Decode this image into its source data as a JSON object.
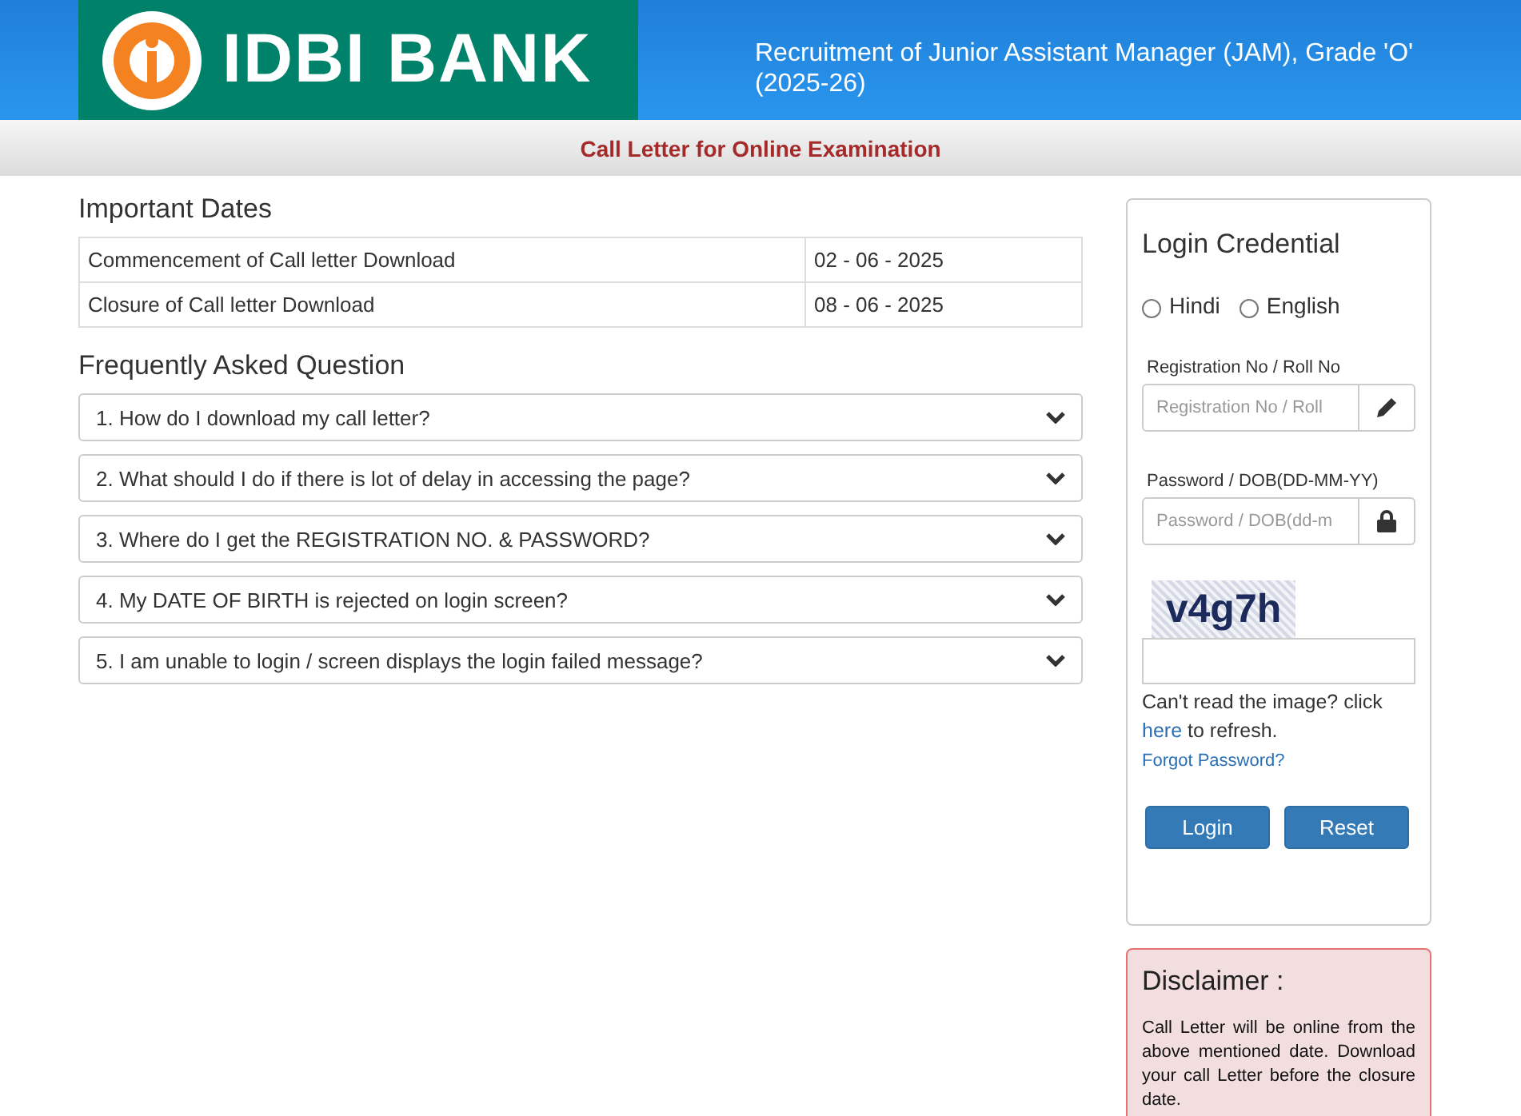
{
  "header": {
    "logo_text": "IDBI BANK",
    "title": "Recruitment of Junior Assistant Manager (JAM), Grade 'O' (2025-26)"
  },
  "subheader": {
    "title": "Call Letter for Online Examination"
  },
  "important_dates": {
    "heading": "Important Dates",
    "rows": [
      {
        "label": "Commencement of Call letter Download",
        "date": "02 - 06 - 2025"
      },
      {
        "label": "Closure of Call letter Download",
        "date": "08 - 06 - 2025"
      }
    ]
  },
  "faq": {
    "heading": "Frequently Asked Question",
    "items": [
      {
        "question": "1. How do I download my call letter?",
        "expanded": false
      },
      {
        "question": "2. What should I do if there is lot of delay in accessing the page?",
        "expanded": false
      },
      {
        "question": "3. Where do I get the REGISTRATION NO. & PASSWORD?",
        "expanded": false
      },
      {
        "question": "4. My DATE OF BIRTH is rejected on login screen?",
        "expanded": false
      },
      {
        "question": "5. I am unable to login / screen displays the login failed message?",
        "expanded": false
      }
    ]
  },
  "login": {
    "heading": "Login Credential",
    "languages": [
      {
        "label": "Hindi",
        "selected": false
      },
      {
        "label": "English",
        "selected": false
      }
    ],
    "fields": [
      {
        "kind": "text",
        "label": "Registration No / Roll No",
        "placeholder": "Registration No / Roll"
      },
      {
        "kind": "password",
        "label": "Password / DOB(DD-MM-YY)",
        "placeholder": "Password / DOB(dd-m"
      }
    ],
    "captcha": "v4g7h",
    "refresh_text_before": "Can't read the image? click",
    "refresh_link": "here",
    "refresh_text_after": "to refresh.",
    "forgot_link": "Forgot Password?",
    "buttons": [
      "Login",
      "Reset"
    ]
  },
  "disclaimer": {
    "heading": "Disclaimer :",
    "text": "Call Letter will be online from the above mentioned date. Download your call Letter before the closure date."
  }
}
